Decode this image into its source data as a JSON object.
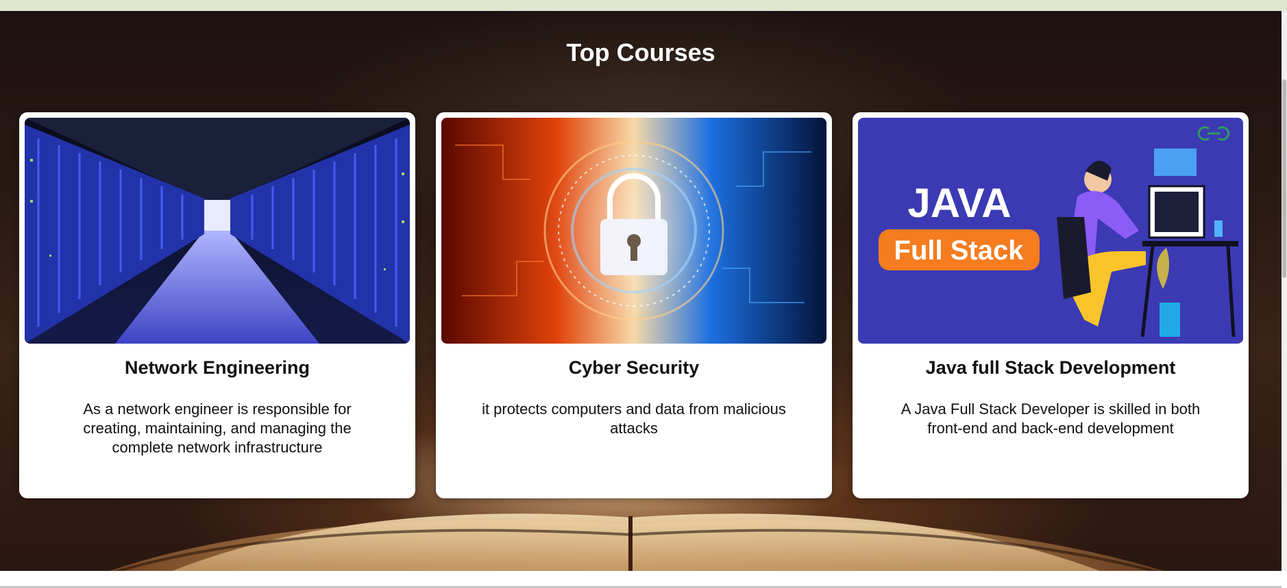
{
  "section": {
    "title": "Top Courses"
  },
  "courses": [
    {
      "title": "Network Engineering",
      "description": "As a network engineer is responsible for creating, maintaining, and managing the complete network infrastructure",
      "image": "data-center-server-rows"
    },
    {
      "title": "Cyber Security",
      "description": "it protects computers and data from malicious attacks",
      "image": "digital-padlock"
    },
    {
      "title": "Java full Stack Development",
      "description": "A Java Full Stack Developer is skilled in both front-end and back-end development",
      "image": "java-developer-illustration",
      "image_text": {
        "line1": "JAVA",
        "line2": "Full Stack"
      }
    }
  ],
  "colors": {
    "topbar": "#dfe8cf",
    "card_bg": "#ffffff",
    "java_bg": "#3b3ab3",
    "java_pill": "#f57c1f",
    "brand_logo": "#2f9e5a"
  }
}
